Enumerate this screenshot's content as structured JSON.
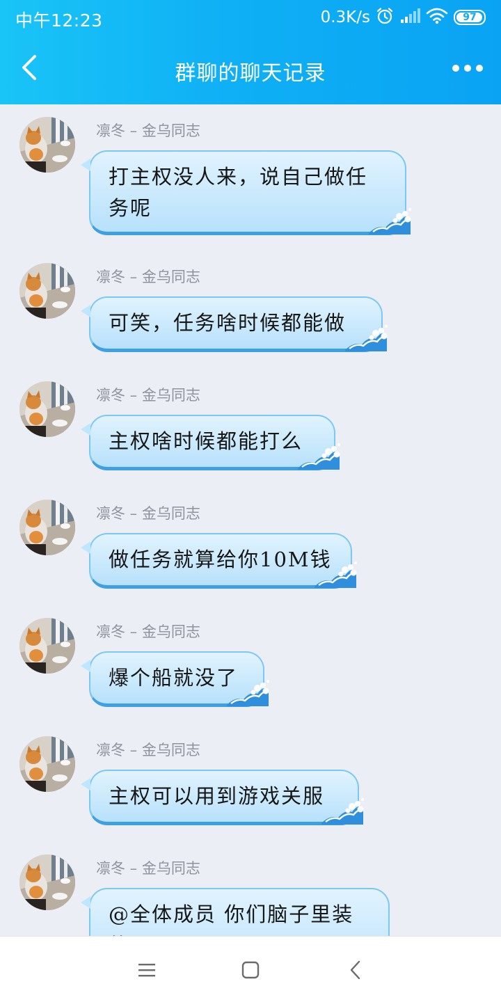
{
  "status_bar": {
    "time": "中午12:23",
    "net_speed": "0.3K/s",
    "battery_level": "97",
    "battery_fraction": 0.97,
    "icons": [
      "alarm-icon",
      "signal-icon",
      "wifi-icon",
      "battery-icon"
    ]
  },
  "header": {
    "title": "群聊的聊天记录",
    "back_icon": "back-arrow-icon",
    "more_icon": "more-dots-icon"
  },
  "colors": {
    "header_gradient_start": "#19c4f6",
    "header_gradient_end": "#0aa3f4",
    "background": "#eceef5",
    "bubble_fill": "#b7e1fb",
    "bubble_border": "#3f9fe3",
    "sender_name": "#8e929c"
  },
  "messages": [
    {
      "sender": "凛冬 – 金乌同志",
      "text": "打主权没人来，说自己做任务呢"
    },
    {
      "sender": "凛冬 – 金乌同志",
      "text": "可笑，任务啥时候都能做"
    },
    {
      "sender": "凛冬 – 金乌同志",
      "text": "主权啥时候都能打么"
    },
    {
      "sender": "凛冬 – 金乌同志",
      "text": "做任务就算给你10M钱"
    },
    {
      "sender": "凛冬 – 金乌同志",
      "text": "爆个船就没了"
    },
    {
      "sender": "凛冬 – 金乌同志",
      "text": "主权可以用到游戏关服"
    },
    {
      "sender": "凛冬 – 金乌同志",
      "text": "@全体成员 你们脑子里装的是"
    }
  ],
  "nav_bar": {
    "menu_icon": "menu-icon",
    "home_icon": "home-square-icon",
    "back_icon": "back-triangle-icon"
  }
}
